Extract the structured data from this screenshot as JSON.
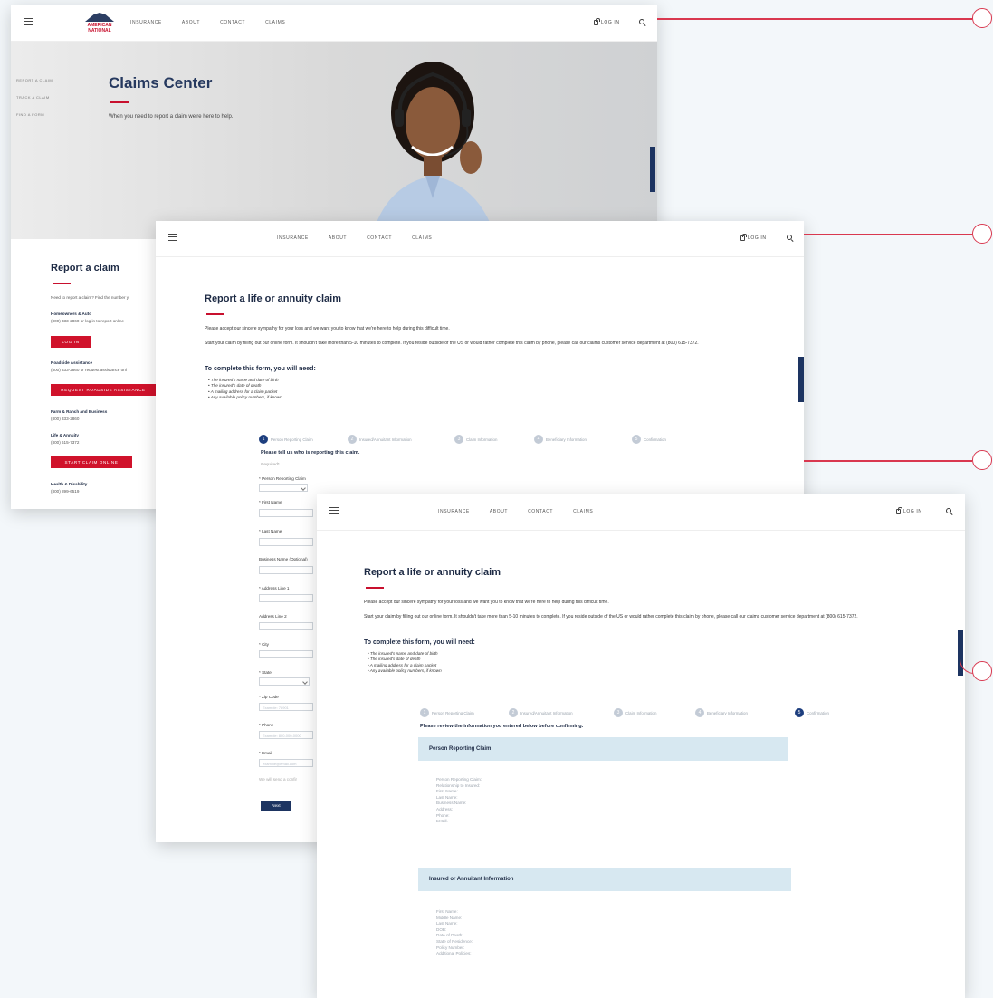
{
  "nav": {
    "links": [
      "INSURANCE",
      "ABOUT",
      "CONTACT",
      "CLAIMS"
    ],
    "login": "LOG IN",
    "logo": "AMERICAN NATIONAL"
  },
  "screen1": {
    "side_links": [
      "REPORT A CLAIM",
      "TRACK A CLAIM",
      "FIND A FORM"
    ],
    "hero_title": "Claims Center",
    "hero_sub": "When you need to report a claim we're here to help.",
    "report_title": "Report a claim",
    "intro": "Need to report a claim? Find the number y",
    "items": [
      {
        "name": "Homeowners & Auto",
        "detail": "(800) 333-2860 or log in to report online",
        "button": "LOG IN"
      },
      {
        "name": "Roadside Assistance",
        "detail": "(800) 333-2860 or request assistance onl",
        "button": "REQUEST ROADSIDE ASSISTANCE"
      },
      {
        "name": "Farm & Ranch and Business",
        "detail": "(800) 333-2860",
        "button": ""
      },
      {
        "name": "Life & Annuity",
        "detail": "(800) 615-7372",
        "button": "START CLAIM ONLINE"
      },
      {
        "name": "Health & Disability",
        "detail": "(800) 899-6519",
        "button": ""
      }
    ]
  },
  "claim": {
    "title": "Report a life or annuity claim",
    "p1": "Please accept our sincere sympathy for your loss and we want you to know that we're here to help during this difficult time.",
    "p2": "Start your claim by filling out our online form. It shouldn't take more than 5-10 minutes to complete. If you reside outside of the US or would rather complete this claim by phone, please call our claims customer service department at (800) 615-7372.",
    "need_title": "To complete this form, you will need:",
    "needs": [
      "The insured's name and date of birth",
      "The insured's date of death",
      "A mailing address for a claim packet",
      "Any available policy numbers, if known"
    ]
  },
  "steps": [
    "Person Reporting Claim",
    "Insured/Annuitant Information",
    "Claim Information",
    "Beneficiary Information",
    "Confirmation"
  ],
  "form": {
    "heading": "Please tell us who is reporting this claim.",
    "required": "Required*",
    "fields": [
      "* Person Reporting Claim",
      "* First Name",
      "* Last Name",
      "Business Name (Optional)",
      "* Address Line 1",
      "Address Line 2",
      "* City",
      "* State",
      "* Zip Code",
      "* Phone",
      "* Email"
    ],
    "zip_ph": "Example: 78901",
    "phone_ph": "Example: 800-000-0000",
    "email_ph": "example@email.com",
    "note": "We will send a confir",
    "next": "Next"
  },
  "confirm": {
    "heading": "Please review the information you entered below before confirming.",
    "section1": "Person Reporting Claim",
    "fields1": [
      "Person Reporting Claim:",
      "Relationship to Insured:",
      "First Name:",
      "Last Name:",
      "Business Name:",
      "Address:",
      "Phone:",
      "Email:"
    ],
    "section2": "Insured or Annuitant Information",
    "fields2": [
      "First Name:",
      "Middle Name:",
      "Last Name:",
      "DOB:",
      "Date of Death:",
      "State of Residence:",
      "Policy Number:",
      "Additional Policies:"
    ]
  },
  "colors": {
    "accent": "#c8102e",
    "navy": "#1d3461",
    "callout": "#d9384f"
  }
}
